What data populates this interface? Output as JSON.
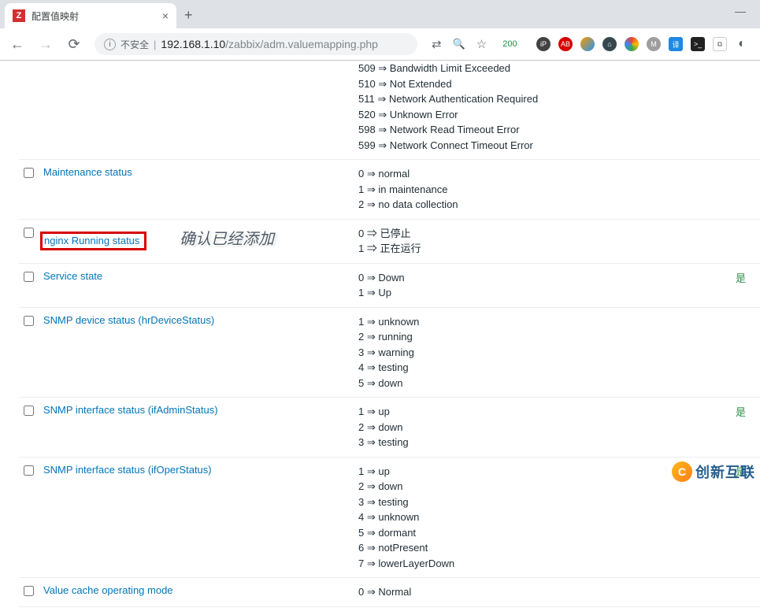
{
  "browser": {
    "tab_title": "配置值映射",
    "insecure_label": "不安全",
    "url_host": "192.168.1.10",
    "url_path": "/zabbix/adm.valuemapping.php",
    "status_code": "200"
  },
  "top_partial_mappings": [
    "509 ⇒ Bandwidth Limit Exceeded",
    "510 ⇒ Not Extended",
    "511 ⇒ Network Authentication Required",
    "520 ⇒ Unknown Error",
    "598 ⇒ Network Read Timeout Error",
    "599 ⇒ Network Connect Timeout Error"
  ],
  "annotation": "确认已经添加",
  "yes_label": "是",
  "rows": [
    {
      "name": "Maintenance status",
      "mappings": [
        "0 ⇒ normal",
        "1 ⇒ in maintenance",
        "2 ⇒ no data collection"
      ],
      "flag": ""
    },
    {
      "name": "nginx Running status",
      "highlight": true,
      "mappings": [
        "0 ⇒ 已停止",
        "1 ⇒ 正在运行"
      ],
      "flag": ""
    },
    {
      "name": "Service state",
      "mappings": [
        "0 ⇒ Down",
        "1 ⇒ Up"
      ],
      "flag": "是"
    },
    {
      "name": "SNMP device status (hrDeviceStatus)",
      "mappings": [
        "1 ⇒ unknown",
        "2 ⇒ running",
        "3 ⇒ warning",
        "4 ⇒ testing",
        "5 ⇒ down"
      ],
      "flag": ""
    },
    {
      "name": "SNMP interface status (ifAdminStatus)",
      "mappings": [
        "1 ⇒ up",
        "2 ⇒ down",
        "3 ⇒ testing"
      ],
      "flag": "是"
    },
    {
      "name": "SNMP interface status (ifOperStatus)",
      "mappings": [
        "1 ⇒ up",
        "2 ⇒ down",
        "3 ⇒ testing",
        "4 ⇒ unknown",
        "5 ⇒ dormant",
        "6 ⇒ notPresent",
        "7 ⇒ lowerLayerDown"
      ],
      "flag": "是"
    },
    {
      "name": "Value cache operating mode",
      "mappings": [
        "0 ⇒ Normal"
      ],
      "flag": ""
    }
  ],
  "watermark": "创新互联"
}
